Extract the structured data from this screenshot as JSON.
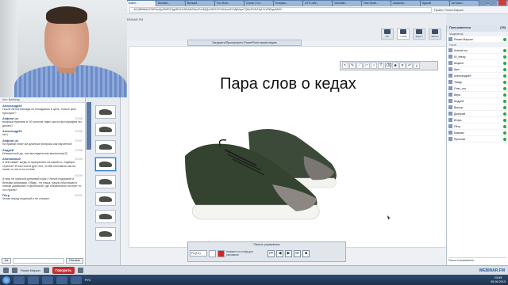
{
  "browser": {
    "tabs": [
      "Eddm...",
      "BorsaM...",
      "BorsaM...",
      "Fox Hom...",
      "Comm | Co...",
      "Kompan...",
      "LST LAB |",
      "Vkontakt...",
      "Yaw Srote...",
      "Zadacha...",
      "Agorait",
      "Антикол...",
      "CRDD Feri..."
    ],
    "url": "...N1Q8M6ArNTARhmQyNWE0YjgMDU1NDhMMGkxZlc2MjQzODISZ2YANJsrhDYjNjh9pcTQ8cZIXNZXyl+hYfNDgwNWI+",
    "extra": "Привет, Роман Марьин"
  },
  "header": {
    "logo": "WEBINAR.FM",
    "upload_label": "Загрузить/Просмотреть PowerPoint презентацию",
    "buttons": [
      {
        "label": "Чат",
        "icon": "chat-icon"
      },
      {
        "label": "Слайд",
        "icon": "slide-icon"
      },
      {
        "label": "Видео",
        "icon": "video-icon"
      },
      {
        "label": "Файлы",
        "icon": "files-icon"
      }
    ]
  },
  "slide": {
    "title": "Пара слов о кедах",
    "image": "sneaker-photo"
  },
  "chat": {
    "header": "Чат: Вебинар",
    "messages": [
      {
        "name": "Александр69",
        "time": "",
        "text": "После пятых взгляда не попадаешь в цель, только фон прессуют?"
      },
      {
        "name": "Анфиот-эх",
        "time": "23:55",
        "text": "вопросы приняли в 10 голосов таких как на фотографии это делать?"
      },
      {
        "name": "Александр69",
        "time": "23:56",
        "text": "нет)"
      },
      {
        "name": "Анфиот-эх",
        "time": "23:57",
        "text": "на правой стоят же длинные вопросы как паркетной"
      },
      {
        "name": "Андрей",
        "time": "23:58",
        "text": "Интересный да, они выглядели как мокасинах(3)"
      },
      {
        "name": "Анонимный",
        "time": "23:59",
        "text": "а чем может когда-то прикрепить на какой-то, подборе стрелок? В частности для того, чтобы поставить как на показ то что и на чтение"
      },
      {
        "name": "",
        "time": "00:00",
        "text": "А еще не красной кремовой коже с белой подошвой и белыми шнурками. Обувь - не наша. Какую обычными в поиске домашних и футболкой, где обязательно постоит то что нужно?"
      },
      {
        "name": "Пётр",
        "time": "00:01",
        "text": "Читал перед покупкой и не спешил"
      }
    ],
    "send_label": "Послать",
    "font_label": "Aa"
  },
  "controls": {
    "title": "Панель управления",
    "zoom": "Fit (1:1)",
    "hint": "Нажмите на слайд для рисования",
    "nav": [
      "⏮",
      "◀",
      "▶",
      "⏭",
      "■"
    ]
  },
  "people": {
    "header": "Пользователи",
    "count": "(25)",
    "groups": [
      {
        "name": "Модератор",
        "members": [
          "Роман Марьин"
        ]
      },
      {
        "name": "Гости",
        "members": [
          "Ankhat-xxx",
          "Ю_Mewy",
          "Анфиот",
          "Alex",
          "Александр69",
          "Тимур",
          "Олег_ххх",
          "Вера",
          "Андрей",
          "Виктор",
          "Дмитрий",
          "Игорь",
          "Пётр",
          "Максим",
          "Ярослав"
        ]
      }
    ],
    "footer": "Поиск пользователя"
  },
  "bottom": {
    "speak_label": "Говорить",
    "user": "Роман Марьин",
    "brand": "WEBINAR.FM"
  },
  "taskbar": {
    "lang": "РУС",
    "time": "23:59",
    "date": "05.06.2013"
  }
}
